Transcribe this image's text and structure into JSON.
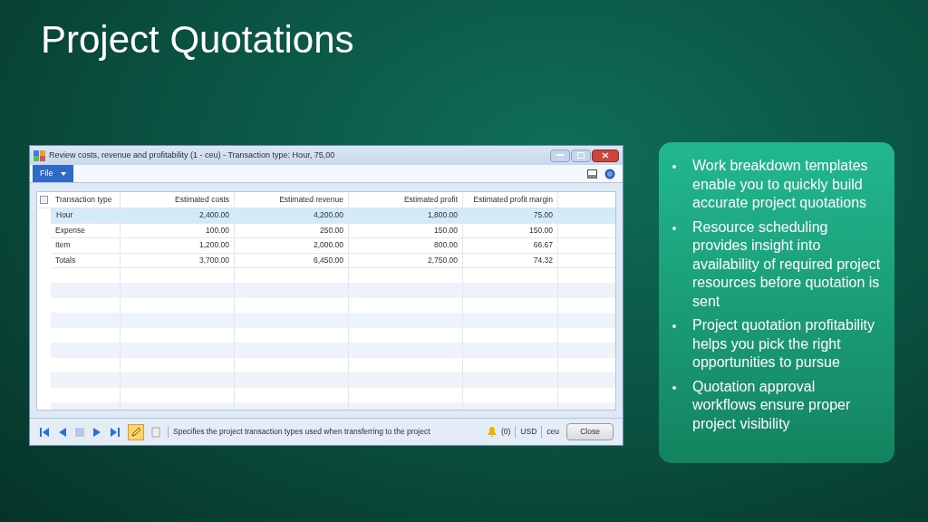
{
  "slide": {
    "title": "Project Quotations"
  },
  "window": {
    "title": "Review costs, revenue and profitability (1 - ceu) - Transaction type: Hour, 75,00",
    "menu": "File"
  },
  "table": {
    "select_all_checked": false,
    "columns": [
      "Transaction type",
      "Estimated costs",
      "Estimated revenue",
      "Estimated profit",
      "Estimated profit margin"
    ],
    "rows": [
      {
        "cells": [
          "Hour",
          "2,400.00",
          "4,200.00",
          "1,800.00",
          "75.00"
        ],
        "selected": true
      },
      {
        "cells": [
          "Expense",
          "100.00",
          "250.00",
          "150.00",
          "150.00"
        ],
        "selected": false
      },
      {
        "cells": [
          "Item",
          "1,200.00",
          "2,000.00",
          "800.00",
          "66.67"
        ],
        "selected": false
      },
      {
        "cells": [
          "Totals",
          "3,700.00",
          "6,450.00",
          "2,750.00",
          "74.32"
        ],
        "selected": false
      }
    ]
  },
  "status_bar": {
    "help_text": "Specifies the project transaction types used when transferring to the project",
    "notifications": "(0)",
    "currency": "USD",
    "company": "ceu",
    "close_button": "Close"
  },
  "bullets": [
    "Work breakdown templates enable you to quickly build accurate project quotations",
    "Resource scheduling provides insight into availability of required project resources before quotation is sent",
    "Project quotation profitability helps you pick the right opportunities to pursue",
    "Quotation approval workflows ensure proper project visibility"
  ]
}
